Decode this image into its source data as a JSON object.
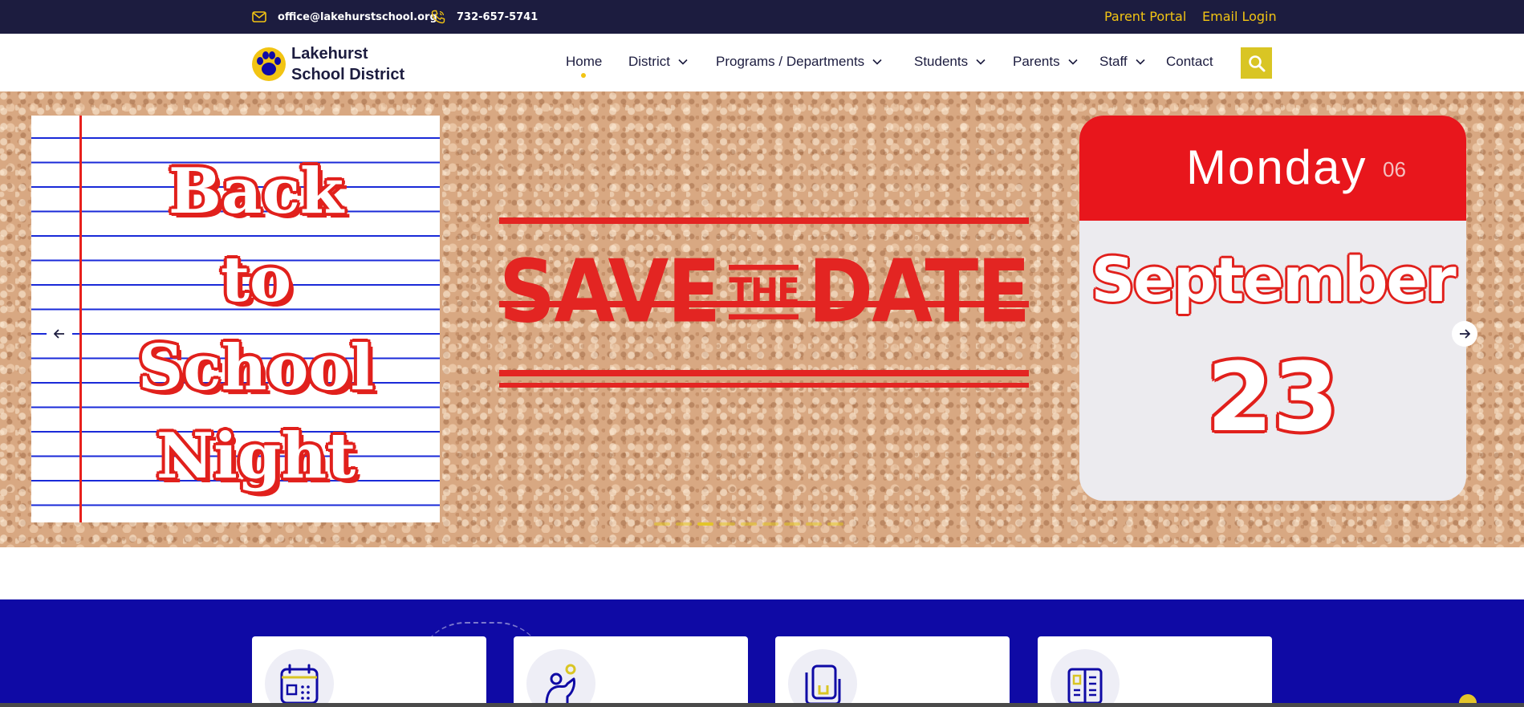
{
  "topbar": {
    "email": "office@lakehurstschool.org",
    "phone": "732-657-5741",
    "parent_portal": "Parent Portal",
    "email_login": "Email Login",
    "accent_color": "#f2c413",
    "background_color": "#1c1c3f"
  },
  "header": {
    "logo_line1": "Lakehurst",
    "logo_line2": "School District",
    "nav": [
      {
        "label": "Home",
        "active": true,
        "dropdown": false
      },
      {
        "label": "District",
        "dropdown": true
      },
      {
        "label": "Programs / Departments",
        "dropdown": true
      },
      {
        "label": "Students",
        "dropdown": true
      },
      {
        "label": "Parents",
        "dropdown": true
      },
      {
        "label": "Staff",
        "dropdown": true
      },
      {
        "label": "Contact",
        "dropdown": false
      }
    ],
    "search_icon": "search-icon"
  },
  "hero": {
    "notebook_words": [
      "Back",
      "to",
      "School",
      "Night"
    ],
    "save_the_date": {
      "left": "SAVE",
      "middle": "THE",
      "right": "DATE"
    },
    "calendar": {
      "day": "Monday",
      "day_number": "06",
      "month": "September",
      "date": "23"
    },
    "slide_count": 9,
    "active_slide": 2,
    "prev_icon": "arrow-left-icon",
    "next_icon": "arrow-right-icon"
  },
  "features": {
    "background_color": "#0f0aa5",
    "cards": [
      {
        "icon": "calendar-icon"
      },
      {
        "icon": "student-icon"
      },
      {
        "icon": "folder-icon"
      },
      {
        "icon": "book-icon"
      }
    ]
  }
}
